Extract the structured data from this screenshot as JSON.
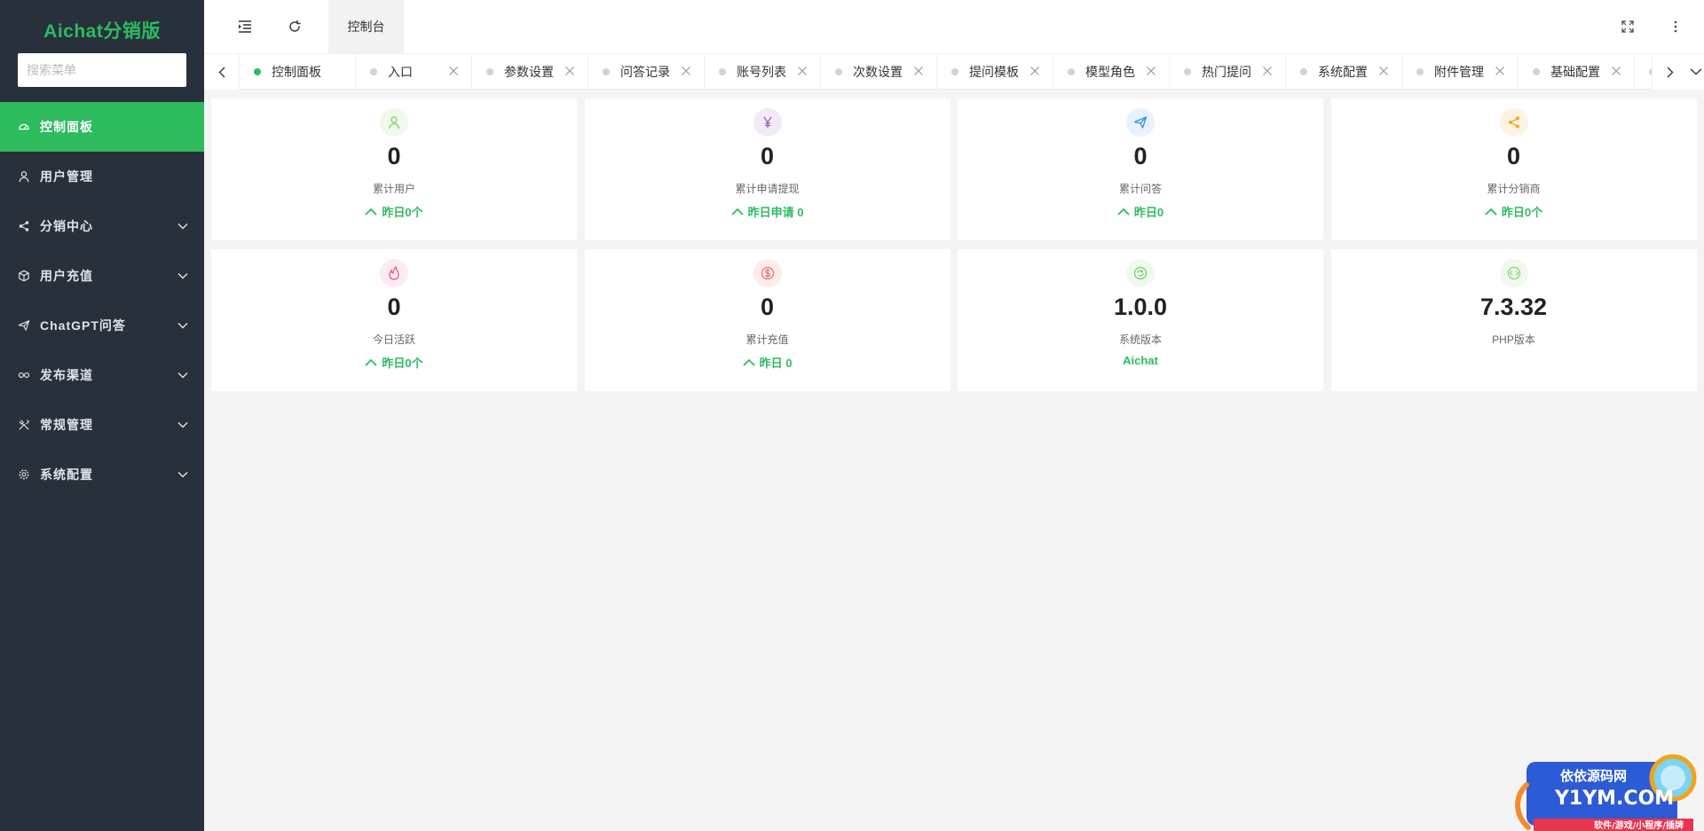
{
  "app": {
    "title": "Aichat分销版"
  },
  "search": {
    "placeholder": "搜索菜单"
  },
  "sidebar": {
    "items": [
      {
        "label": "控制面板",
        "icon": "dashboard-icon",
        "active": true,
        "has_arrow": false
      },
      {
        "label": "用户管理",
        "icon": "user-icon",
        "active": false,
        "has_arrow": false
      },
      {
        "label": "分销中心",
        "icon": "share-icon",
        "active": false,
        "has_arrow": true
      },
      {
        "label": "用户充值",
        "icon": "cube-icon",
        "active": false,
        "has_arrow": true
      },
      {
        "label": "ChatGPT问答",
        "icon": "send-icon",
        "active": false,
        "has_arrow": true
      },
      {
        "label": "发布渠道",
        "icon": "link-icon",
        "active": false,
        "has_arrow": true
      },
      {
        "label": "常规管理",
        "icon": "tools-icon",
        "active": false,
        "has_arrow": true
      },
      {
        "label": "系统配置",
        "icon": "gear-icon",
        "active": false,
        "has_arrow": true
      }
    ]
  },
  "header": {
    "tab_label": "控制台"
  },
  "tabs": [
    {
      "label": "控制面板",
      "active": true,
      "closable": false
    },
    {
      "label": "入口",
      "active": false,
      "closable": true
    },
    {
      "label": "参数设置",
      "active": false,
      "closable": true
    },
    {
      "label": "问答记录",
      "active": false,
      "closable": true
    },
    {
      "label": "账号列表",
      "active": false,
      "closable": true
    },
    {
      "label": "次数设置",
      "active": false,
      "closable": true
    },
    {
      "label": "提问模板",
      "active": false,
      "closable": true
    },
    {
      "label": "模型角色",
      "active": false,
      "closable": true
    },
    {
      "label": "热门提问",
      "active": false,
      "closable": true
    },
    {
      "label": "系统配置",
      "active": false,
      "closable": true
    },
    {
      "label": "附件管理",
      "active": false,
      "closable": true
    },
    {
      "label": "基础配置",
      "active": false,
      "closable": true
    },
    {
      "label": "充",
      "active": false,
      "closable": false
    }
  ],
  "cards": [
    {
      "icon": "user-icon",
      "icon_color": "#8bd17c",
      "icon_bg": "#f0f9ec",
      "value": "0",
      "label": "累计用户",
      "sub": "昨日0个",
      "sub_arrow": true
    },
    {
      "icon": "yen-icon",
      "icon_color": "#9b59b6",
      "icon_bg": "#f3eaf8",
      "value": "0",
      "label": "累计申请提现",
      "sub": "昨日申请 0",
      "sub_arrow": true
    },
    {
      "icon": "send-icon",
      "icon_color": "#3a8ee6",
      "icon_bg": "#e8f2fc",
      "value": "0",
      "label": "累计问答",
      "sub": "昨日0",
      "sub_arrow": true
    },
    {
      "icon": "share-icon",
      "icon_color": "#f5a623",
      "icon_bg": "#fdf3e3",
      "value": "0",
      "label": "累计分销商",
      "sub": "昨日0个",
      "sub_arrow": true
    },
    {
      "icon": "fire-icon",
      "icon_color": "#e95c7e",
      "icon_bg": "#fcebf0",
      "value": "0",
      "label": "今日活跃",
      "sub": "昨日0个",
      "sub_arrow": true
    },
    {
      "icon": "dollar-icon",
      "icon_color": "#e57373",
      "icon_bg": "#fcecec",
      "value": "0",
      "label": "累计充值",
      "sub": "昨日 0",
      "sub_arrow": true
    },
    {
      "icon": "refresh-circle-icon",
      "icon_color": "#6fcf6a",
      "icon_bg": "#effaee",
      "value": "1.0.0",
      "label": "系统版本",
      "sub": "Aichat",
      "sub_arrow": false
    },
    {
      "icon": "code-icon",
      "icon_color": "#8bd17c",
      "icon_bg": "#f0f9ec",
      "value": "7.3.32",
      "label": "PHP版本",
      "sub": "",
      "sub_arrow": false
    }
  ],
  "watermark": {
    "line1": "依依源码网",
    "line2": "Y1YM.COM",
    "line3": "软件/游戏/小程序/插牌"
  },
  "colors": {
    "accent": "#2dbb5e",
    "sidebar_bg": "#28313b",
    "page_bg": "#f4f4f4"
  }
}
